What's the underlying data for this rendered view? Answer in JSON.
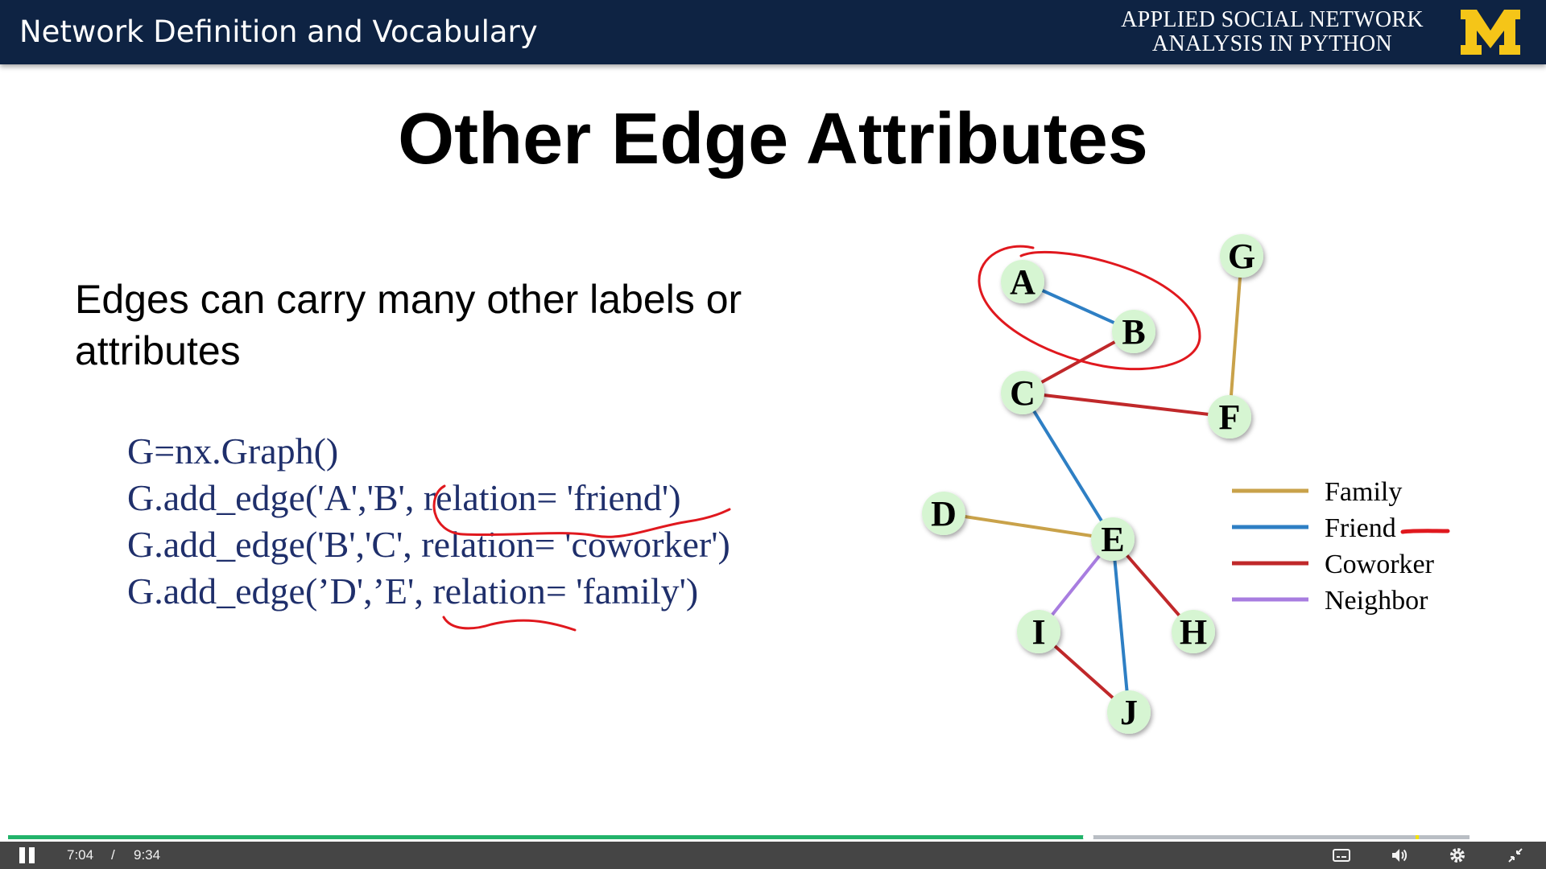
{
  "header": {
    "title": "Network Definition and Vocabulary",
    "course_line1": "APPLIED SOCIAL NETWORK",
    "course_line2": "ANALYSIS IN PYTHON",
    "logo_letter": "M",
    "colors": {
      "background": "#0e2343",
      "logo": "#f5c518"
    }
  },
  "slide": {
    "title": "Other Edge Attributes",
    "body_line1": "Edges can carry many other labels or",
    "body_line2": "attributes",
    "code": [
      "G=nx.Graph()",
      "G.add_edge('A','B', relation= 'friend')",
      "G.add_edge('B','C', relation= 'coworker')",
      "G.add_edge(’D',’E', relation= 'family')"
    ]
  },
  "graph": {
    "nodes": [
      "A",
      "B",
      "C",
      "D",
      "E",
      "F",
      "G",
      "H",
      "I",
      "J"
    ],
    "edges": [
      {
        "from": "A",
        "to": "B",
        "relation": "Friend"
      },
      {
        "from": "B",
        "to": "C",
        "relation": "Coworker"
      },
      {
        "from": "C",
        "to": "F",
        "relation": "Coworker"
      },
      {
        "from": "G",
        "to": "F",
        "relation": "Family"
      },
      {
        "from": "C",
        "to": "E",
        "relation": "Friend"
      },
      {
        "from": "D",
        "to": "E",
        "relation": "Family"
      },
      {
        "from": "E",
        "to": "H",
        "relation": "Coworker"
      },
      {
        "from": "E",
        "to": "I",
        "relation": "Neighbor"
      },
      {
        "from": "E",
        "to": "J",
        "relation": "Friend"
      },
      {
        "from": "I",
        "to": "J",
        "relation": "Coworker"
      }
    ],
    "legend": [
      {
        "label": "Family",
        "color": "#c9a24a"
      },
      {
        "label": "Friend",
        "color": "#2e7fc4"
      },
      {
        "label": "Coworker",
        "color": "#c0282a"
      },
      {
        "label": "Neighbor",
        "color": "#a87de0"
      }
    ],
    "node_fill": "#d6f5d2",
    "annotation_color": "#e0181e"
  },
  "player": {
    "current_time": "7:04",
    "separator": "/",
    "duration": "9:34",
    "played_fraction": 0.739,
    "accent_color": "#22b36a"
  }
}
